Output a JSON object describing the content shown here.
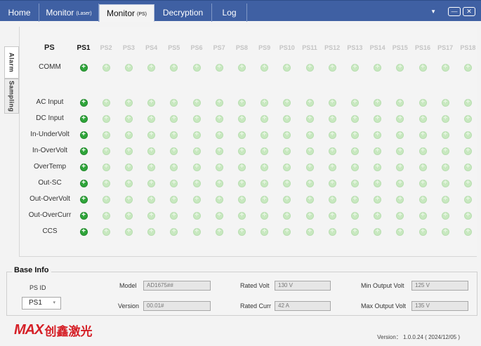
{
  "tabs": [
    {
      "label": "Home",
      "sub": "",
      "active": false
    },
    {
      "label": "Monitor",
      "sub": "(Laser)",
      "active": false
    },
    {
      "label": "Monitor",
      "sub": "(PS)",
      "active": true
    },
    {
      "label": "Decryption",
      "sub": "",
      "active": false
    },
    {
      "label": "Log",
      "sub": "",
      "active": false
    }
  ],
  "window": {
    "dropdown_icon": "▼",
    "minimize_icon": "—",
    "close_icon": "✕"
  },
  "side_tabs": [
    {
      "label": "Alarm",
      "active": false
    },
    {
      "label": "Sampling",
      "active": true
    }
  ],
  "grid": {
    "corner": "PS",
    "columns": [
      "PS1",
      "PS2",
      "PS3",
      "PS4",
      "PS5",
      "PS6",
      "PS7",
      "PS8",
      "PS9",
      "PS10",
      "PS11",
      "PS12",
      "PS13",
      "PS14",
      "PS15",
      "PS16",
      "PS17",
      "PS18"
    ],
    "rows": [
      {
        "label": "COMM",
        "states": [
          1,
          0,
          0,
          0,
          0,
          0,
          0,
          0,
          0,
          0,
          0,
          0,
          0,
          0,
          0,
          0,
          0,
          0
        ]
      },
      {
        "label": "AC Input",
        "states": [
          1,
          0,
          0,
          0,
          0,
          0,
          0,
          0,
          0,
          0,
          0,
          0,
          0,
          0,
          0,
          0,
          0,
          0
        ]
      },
      {
        "label": "DC Input",
        "states": [
          1,
          0,
          0,
          0,
          0,
          0,
          0,
          0,
          0,
          0,
          0,
          0,
          0,
          0,
          0,
          0,
          0,
          0
        ]
      },
      {
        "label": "In-UnderVolt",
        "states": [
          1,
          0,
          0,
          0,
          0,
          0,
          0,
          0,
          0,
          0,
          0,
          0,
          0,
          0,
          0,
          0,
          0,
          0
        ]
      },
      {
        "label": "In-OverVolt",
        "states": [
          1,
          0,
          0,
          0,
          0,
          0,
          0,
          0,
          0,
          0,
          0,
          0,
          0,
          0,
          0,
          0,
          0,
          0
        ]
      },
      {
        "label": "OverTemp",
        "states": [
          1,
          0,
          0,
          0,
          0,
          0,
          0,
          0,
          0,
          0,
          0,
          0,
          0,
          0,
          0,
          0,
          0,
          0
        ]
      },
      {
        "label": "Out-SC",
        "states": [
          1,
          0,
          0,
          0,
          0,
          0,
          0,
          0,
          0,
          0,
          0,
          0,
          0,
          0,
          0,
          0,
          0,
          0
        ]
      },
      {
        "label": "Out-OverVolt",
        "states": [
          1,
          0,
          0,
          0,
          0,
          0,
          0,
          0,
          0,
          0,
          0,
          0,
          0,
          0,
          0,
          0,
          0,
          0
        ]
      },
      {
        "label": "Out-OverCurr",
        "states": [
          1,
          0,
          0,
          0,
          0,
          0,
          0,
          0,
          0,
          0,
          0,
          0,
          0,
          0,
          0,
          0,
          0,
          0
        ]
      },
      {
        "label": "CCS",
        "states": [
          1,
          0,
          0,
          0,
          0,
          0,
          0,
          0,
          0,
          0,
          0,
          0,
          0,
          0,
          0,
          0,
          0,
          0
        ]
      }
    ],
    "led_on_color": "#2fa53a",
    "led_off_color": "#c8e8c0"
  },
  "base_info": {
    "title": "Base Info",
    "ps_id_label": "PS ID",
    "ps_id_value": "PS1",
    "ps_id_caret": "▾",
    "model_label": "Model",
    "model_value": "AD1675##",
    "version_label": "Version",
    "version_value": "00.01#",
    "rated_volt_label": "Rated Volt",
    "rated_volt_value": "130 V",
    "rated_curr_label": "Rated Curr",
    "rated_curr_value": "42 A",
    "min_output_volt_label": "Min Output Volt",
    "min_output_volt_value": "125 V",
    "max_output_volt_label": "Max Output Volt",
    "max_output_volt_value": "135 V"
  },
  "footer": {
    "logo_mark": "MAX",
    "logo_cn": "创鑫激光",
    "version": "Version： 1.0.0.24  ( 2024/12/05 )"
  }
}
